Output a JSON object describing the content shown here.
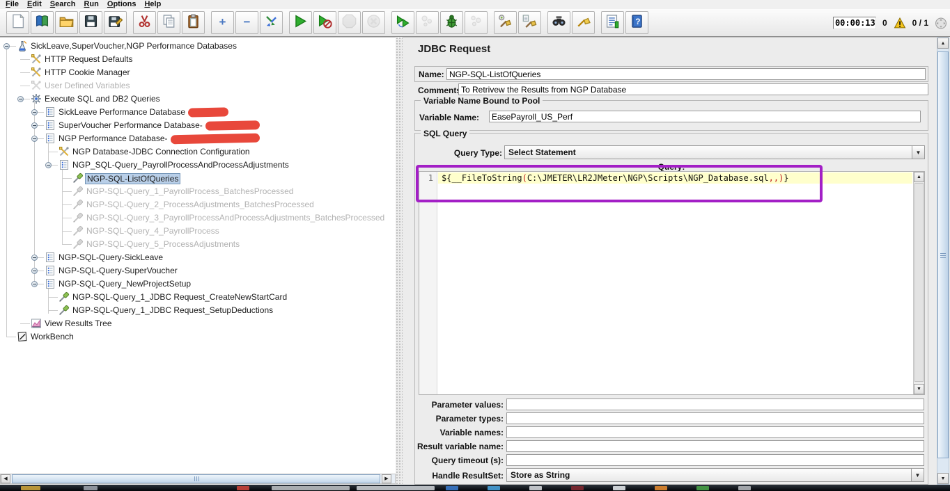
{
  "menu": {
    "items": [
      "File",
      "Edit",
      "Search",
      "Run",
      "Options",
      "Help"
    ]
  },
  "toolbar": {
    "timer": "00:00:13",
    "warning_count": "0",
    "active_threads": "0 / 1",
    "groups": [
      [
        {
          "name": "new"
        },
        {
          "name": "templates"
        },
        {
          "name": "open"
        },
        {
          "name": "save"
        },
        {
          "name": "save-as"
        }
      ],
      [
        {
          "name": "cut"
        },
        {
          "name": "copy"
        },
        {
          "name": "paste"
        }
      ],
      [
        {
          "name": "expand-all"
        },
        {
          "name": "collapse-all"
        },
        {
          "name": "toggle"
        }
      ],
      [
        {
          "name": "start"
        },
        {
          "name": "start-no-pauses"
        },
        {
          "name": "stop",
          "disabled": true
        },
        {
          "name": "shutdown",
          "disabled": true
        }
      ],
      [
        {
          "name": "remote-start-all"
        },
        {
          "name": "remote-stop-all",
          "disabled": true
        },
        {
          "name": "debug-start"
        },
        {
          "name": "remote-shutdown-all",
          "disabled": true
        }
      ],
      [
        {
          "name": "clear"
        },
        {
          "name": "clear-all"
        }
      ],
      [
        {
          "name": "search"
        },
        {
          "name": "search-reset"
        }
      ],
      [
        {
          "name": "function-helper"
        },
        {
          "name": "help"
        }
      ]
    ]
  },
  "tree": {
    "items": [
      {
        "label": "SickLeave,SuperVoucher,NGP Performance Databases",
        "icon": "test-plan",
        "level": 0,
        "handle": true,
        "state": "normal"
      },
      {
        "label": "HTTP Request Defaults",
        "icon": "config",
        "level": 1,
        "handle": false,
        "state": "normal"
      },
      {
        "label": "HTTP Cookie Manager",
        "icon": "config",
        "level": 1,
        "handle": false,
        "state": "normal"
      },
      {
        "label": "User Defined Variables",
        "icon": "config",
        "level": 1,
        "handle": false,
        "state": "disabled"
      },
      {
        "label": "Execute SQL and DB2 Queries",
        "icon": "gear",
        "level": 1,
        "handle": true,
        "state": "normal"
      },
      {
        "label": "SickLeave Performance Database",
        "icon": "controller",
        "level": 2,
        "handle": true,
        "state": "normal",
        "redact_width": 58
      },
      {
        "label": "SuperVoucher Performance Database-",
        "icon": "controller",
        "level": 2,
        "handle": true,
        "state": "normal",
        "redact_width": 78
      },
      {
        "label": "NGP Performance Database-",
        "icon": "controller",
        "level": 2,
        "handle": true,
        "state": "normal",
        "redact_width": 128
      },
      {
        "label": "NGP Database-JDBC Connection Configuration",
        "icon": "config",
        "level": 3,
        "handle": false,
        "state": "normal"
      },
      {
        "label": "NGP_SQL-Query_PayrollProcessAndProcessAdjustments",
        "icon": "controller",
        "level": 3,
        "handle": true,
        "state": "normal"
      },
      {
        "label": "NGP-SQL-ListOfQueries",
        "icon": "sampler",
        "level": 4,
        "handle": false,
        "state": "selected"
      },
      {
        "label": "NGP-SQL-Query_1_PayrollProcess_BatchesProcessed",
        "icon": "sampler",
        "level": 4,
        "handle": false,
        "state": "disabled"
      },
      {
        "label": "NGP-SQL-Query_2_ProcessAdjustments_BatchesProcessed",
        "icon": "sampler",
        "level": 4,
        "handle": false,
        "state": "disabled"
      },
      {
        "label": "NGP-SQL-Query_3_PayrollProcessAndProcessAdjustments_BatchesProcessed",
        "icon": "sampler",
        "level": 4,
        "handle": false,
        "state": "disabled"
      },
      {
        "label": "NGP-SQL-Query_4_PayrollProcess",
        "icon": "sampler",
        "level": 4,
        "handle": false,
        "state": "disabled"
      },
      {
        "label": "NGP-SQL-Query_5_ProcessAdjustments",
        "icon": "sampler",
        "level": 4,
        "handle": false,
        "state": "disabled"
      },
      {
        "label": "NGP-SQL-Query-SickLeave",
        "icon": "controller",
        "level": 2,
        "handle": true,
        "state": "normal"
      },
      {
        "label": "NGP-SQL-Query-SuperVoucher",
        "icon": "controller",
        "level": 2,
        "handle": true,
        "state": "normal"
      },
      {
        "label": "NGP-SQL-Query_NewProjectSetup",
        "icon": "controller",
        "level": 2,
        "handle": true,
        "state": "normal"
      },
      {
        "label": "NGP-SQL-Query_1_JDBC Request_CreateNewStartCard",
        "icon": "sampler",
        "level": 3,
        "handle": false,
        "state": "normal"
      },
      {
        "label": "NGP-SQL-Query_1_JDBC Request_SetupDeductions",
        "icon": "sampler",
        "level": 3,
        "handle": false,
        "state": "normal"
      },
      {
        "label": "View Results Tree",
        "icon": "results-tree",
        "level": 1,
        "handle": false,
        "state": "normal"
      },
      {
        "label": "WorkBench",
        "icon": "workbench",
        "level": 0,
        "handle": false,
        "state": "normal"
      }
    ]
  },
  "panel": {
    "title": "JDBC Request",
    "name_label": "Name:",
    "name_value": "NGP-SQL-ListOfQueries",
    "comments_label": "Comments:",
    "comments_value": "To Retrivew the Results from NGP Database",
    "pool": {
      "legend": "Variable Name Bound to Pool",
      "variable_label": "Variable Name:",
      "variable_value": "EasePayroll_US_Perf"
    },
    "sql": {
      "legend": "SQL Query",
      "query_type_label": "Query Type:",
      "query_type_value": "Select Statement",
      "query_caption": "Query:",
      "line_number": "1",
      "query_text": "${__FileToString(C:\\JMETER\\LR2JMeter\\NGP\\Scripts\\NGP_Database.sql,,)}",
      "query_segments": [
        {
          "text": "${__FileToString",
          "color": "#16160f"
        },
        {
          "text": "(",
          "color": "#c01c1c"
        },
        {
          "text": "C:\\JMETER\\LR2JMeter\\NGP\\Scripts\\NGP_Database.sql",
          "color": "#16160f"
        },
        {
          "text": ",,)",
          "color": "#c01c1c"
        },
        {
          "text": "}",
          "color": "#16160f"
        }
      ],
      "fields": [
        {
          "label": "Parameter values:"
        },
        {
          "label": "Parameter types:"
        },
        {
          "label": "Variable names:"
        },
        {
          "label": "Result variable name:"
        },
        {
          "label": "Query timeout (s):"
        }
      ],
      "handle_label": "Handle ResultSet:",
      "handle_value": "Store as String"
    }
  },
  "colors": {
    "selection": "#b9cfe8",
    "annotation_box": "#a31fc6",
    "redaction": "#e8483b",
    "current_line": "#ffffcc"
  },
  "taskbar": {
    "colors": [
      "#caa23c",
      "#9aa0a8",
      "#c84438",
      "#b8bcc0",
      "#c8ccd0",
      "#3a78c8",
      "#48a0d8",
      "#d0d4d8",
      "#802830",
      "#e0e4e8",
      "#e08830",
      "#48a048",
      "#b0b4b8"
    ]
  }
}
